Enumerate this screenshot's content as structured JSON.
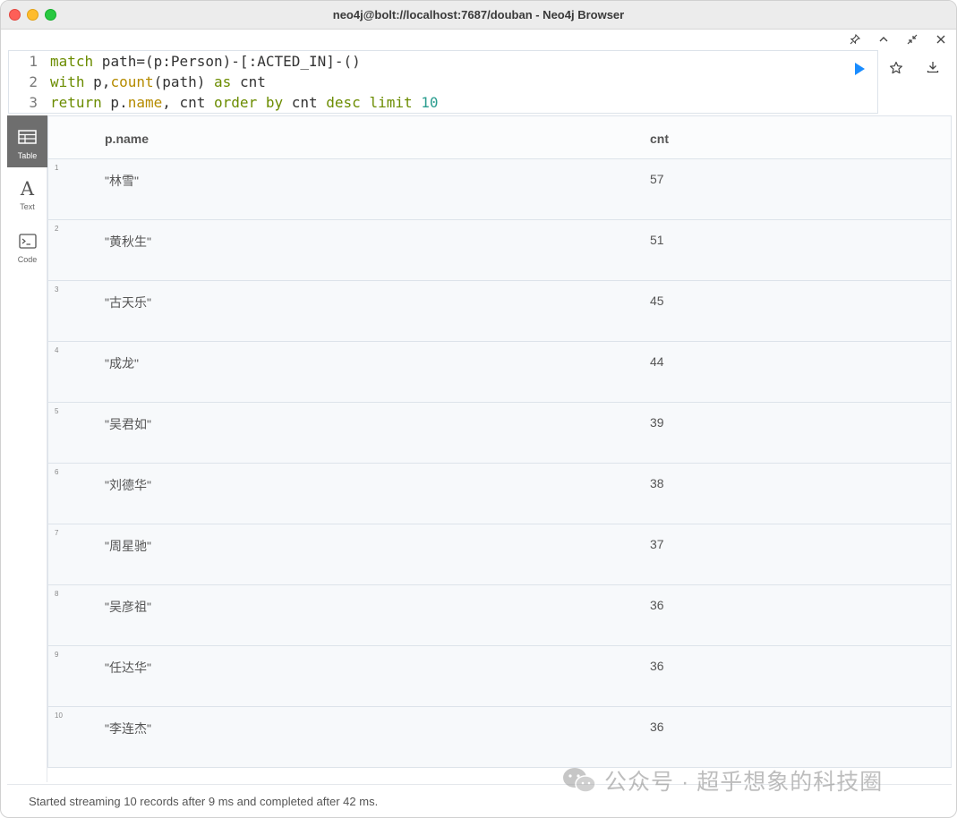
{
  "window": {
    "title": "neo4j@bolt://localhost:7687/douban - Neo4j Browser"
  },
  "frame_controls": {
    "pin": "pin-icon",
    "collapse": "chevron-up-icon",
    "fullscreen": "collapse-arrows-icon",
    "close": "close-icon"
  },
  "editor": {
    "line_numbers": [
      "1",
      "2",
      "3"
    ],
    "line1": {
      "t1": "match",
      "t2": " path=(p:Person)-[:ACTED_IN]-()"
    },
    "line2": {
      "t1": "with",
      "t2": " p,",
      "t3": "count",
      "t4": "(path) ",
      "t5": "as",
      "t6": " cnt"
    },
    "line3": {
      "t1": "return",
      "t2": " p.",
      "t3": "name",
      "t4": ", cnt ",
      "t5": "order",
      "t6": " ",
      "t7": "by",
      "t8": " cnt ",
      "t9": "desc",
      "t10": " ",
      "t11": "limit",
      "t12": " ",
      "t13": "10"
    }
  },
  "actions": {
    "run": "play-icon",
    "favorite": "star-icon",
    "download": "download-icon"
  },
  "sidebar": {
    "items": [
      {
        "label": "Table",
        "icon": "table-icon",
        "active": true
      },
      {
        "label": "Text",
        "icon": "text-icon",
        "active": false
      },
      {
        "label": "Code",
        "icon": "code-icon",
        "active": false
      }
    ]
  },
  "table": {
    "columns": [
      "p.name",
      "cnt"
    ],
    "rows": [
      {
        "idx": "1",
        "name": "\"林雪\"",
        "cnt": "57"
      },
      {
        "idx": "2",
        "name": "\"黄秋生\"",
        "cnt": "51"
      },
      {
        "idx": "3",
        "name": "\"古天乐\"",
        "cnt": "45"
      },
      {
        "idx": "4",
        "name": "\"成龙\"",
        "cnt": "44"
      },
      {
        "idx": "5",
        "name": "\"吴君如\"",
        "cnt": "39"
      },
      {
        "idx": "6",
        "name": "\"刘德华\"",
        "cnt": "38"
      },
      {
        "idx": "7",
        "name": "\"周星驰\"",
        "cnt": "37"
      },
      {
        "idx": "8",
        "name": "\"吴彦祖\"",
        "cnt": "36"
      },
      {
        "idx": "9",
        "name": "\"任达华\"",
        "cnt": "36"
      },
      {
        "idx": "10",
        "name": "\"李连杰\"",
        "cnt": "36"
      }
    ]
  },
  "status": {
    "text": "Started streaming 10 records after 9 ms and completed after 42 ms."
  },
  "watermark": {
    "text": "公众号 · 超乎想象的科技圈",
    "icon": "wechat-icon"
  }
}
